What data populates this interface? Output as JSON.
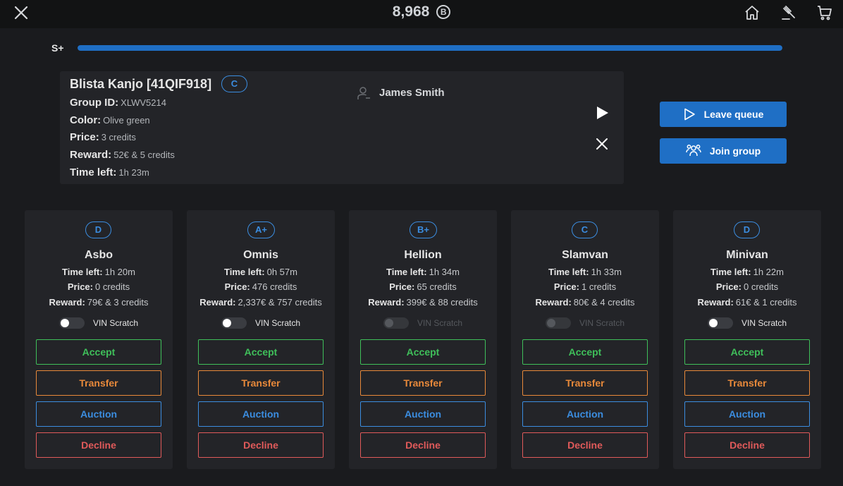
{
  "header": {
    "balance": "8,968",
    "currency_symbol": "B",
    "icons": [
      "close-icon",
      "home-icon",
      "gavel-icon",
      "cart-icon"
    ]
  },
  "progress": {
    "level": "S+",
    "fraction": 1.0
  },
  "current": {
    "title": "Blista Kanjo [41QIF918]",
    "grade": "C",
    "owner": "James Smith",
    "rows": [
      {
        "label": "Group ID:",
        "value": "XLWV5214"
      },
      {
        "label": "Color:",
        "value": "Olive green"
      },
      {
        "label": "Price:",
        "value": "3 credits"
      },
      {
        "label": "Reward:",
        "value": "52€ & 5 credits"
      },
      {
        "label": "Time left:",
        "value": "1h 23m"
      }
    ]
  },
  "actions": {
    "leave_queue": "Leave queue",
    "join_group": "Join group"
  },
  "labels": {
    "time_left": "Time left:",
    "price": "Price:",
    "reward": "Reward:",
    "vin": "VIN Scratch",
    "accept": "Accept",
    "transfer": "Transfer",
    "auction": "Auction",
    "decline": "Decline"
  },
  "offers": [
    {
      "grade": "D",
      "name": "Asbo",
      "time_left": "1h 20m",
      "price": "0 credits",
      "reward": "79€ & 3 credits",
      "vin_enabled": true
    },
    {
      "grade": "A+",
      "name": "Omnis",
      "time_left": "0h 57m",
      "price": "476 credits",
      "reward": "2,337€ & 757 credits",
      "vin_enabled": true
    },
    {
      "grade": "B+",
      "name": "Hellion",
      "time_left": "1h 34m",
      "price": "65 credits",
      "reward": "399€ & 88 credits",
      "vin_enabled": false
    },
    {
      "grade": "C",
      "name": "Slamvan",
      "time_left": "1h 33m",
      "price": "1 credits",
      "reward": "80€ & 4 credits",
      "vin_enabled": false
    },
    {
      "grade": "D",
      "name": "Minivan",
      "time_left": "1h 22m",
      "price": "0 credits",
      "reward": "61€ & 1 credits",
      "vin_enabled": true
    }
  ],
  "colors": {
    "accent": "#1f6fc5",
    "accept": "#3fbf5a",
    "transfer": "#e8893a",
    "auction": "#3b8de0",
    "decline": "#e05a5a"
  }
}
